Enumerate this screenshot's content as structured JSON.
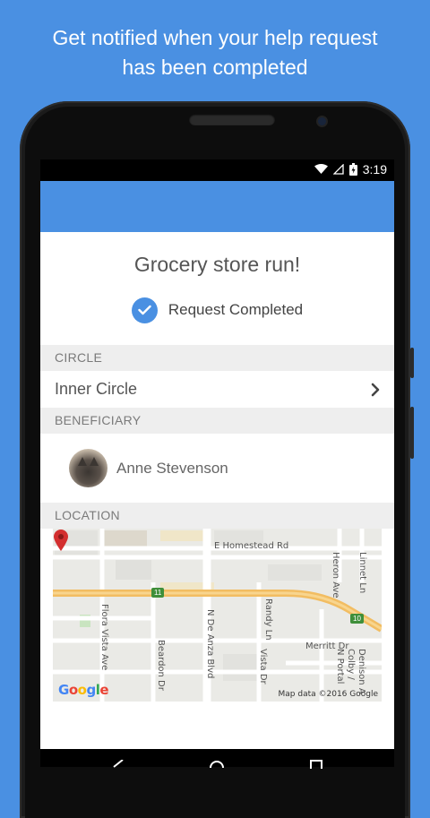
{
  "headline": {
    "line1": "Get notified when your help request",
    "line2": "has been completed"
  },
  "status_bar": {
    "time": "3:19",
    "icons": [
      "wifi-icon",
      "signal-icon",
      "battery-icon"
    ]
  },
  "colors": {
    "background": "#4a90e2",
    "appbar": "#4a90e2",
    "check": "#4a90e2",
    "section_bg": "#eeeeee",
    "map_pin": "#d32f2f"
  },
  "request": {
    "title": "Grocery store run!",
    "status": "Request Completed"
  },
  "sections": {
    "circle_header": "CIRCLE",
    "circle_value": "Inner Circle",
    "beneficiary_header": "BENEFICIARY",
    "beneficiary_name": "Anne Stevenson",
    "location_header": "LOCATION"
  },
  "map": {
    "streets": {
      "homestead": "E Homestead Rd",
      "heron": "Heron Ave",
      "linnet": "Linnet Ln",
      "flora_vista": "Flora Vista Ave",
      "beardon": "Beardon Dr",
      "de_anza": "N De Anza Blvd",
      "randy": "Randy Ln",
      "vista": "Vista Dr",
      "merritt": "Merritt Dr",
      "portal": "N Portal",
      "colby": "Colby /",
      "denison": "Denison A"
    },
    "route_shields": [
      "11",
      "10"
    ],
    "logo": [
      "G",
      "o",
      "o",
      "g",
      "l",
      "e"
    ],
    "attribution": "Map data ©2016 Google"
  },
  "nav_bar": [
    "back-icon",
    "home-icon",
    "recents-icon"
  ]
}
